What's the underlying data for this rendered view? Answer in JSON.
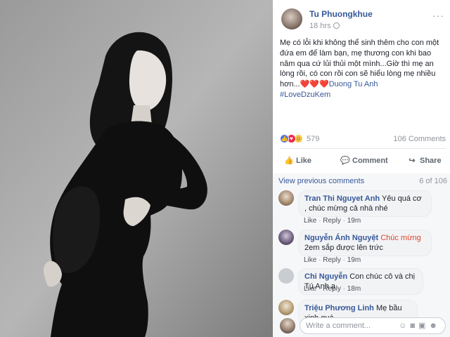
{
  "post": {
    "author": "Tu Phuongkhue",
    "time": "18 hrs",
    "text": "Mẹ có lỗi khi không thể sinh thêm cho con một đứa em để làm bạn, mẹ thương con khi bao năm qua cứ lủi thủi một mình...Giờ thì mẹ an lòng rồi, có con rồi con sẽ hiểu lòng mẹ nhiều hơn...",
    "hearts": "❤️❤️❤️",
    "mention": "Duong Tu Anh",
    "hashtag": "#LoveDzuKem",
    "reaction_count": "579",
    "comment_count": "106 Comments"
  },
  "actions": {
    "like": "Like",
    "comment": "Comment",
    "share": "Share"
  },
  "comments_section": {
    "view_previous": "View previous comments",
    "pager": "6 of 106",
    "items": [
      {
        "name": "Tran Thi Nguyet Anh",
        "text": "Yêu quá cơ , chúc mừng cả nhà nhé",
        "like": "Like",
        "reply": "Reply",
        "time": "19m"
      },
      {
        "name": "Nguyễn Ánh Nguyệt",
        "highlight": "Chúc mừng",
        "text": "2em sắp được lên trức",
        "like": "Like",
        "reply": "Reply",
        "time": "19m"
      },
      {
        "name": "Chi Nguyễn",
        "text": "Con chúc cô và chị Tú Anh ạ",
        "like": "Like",
        "reply": "Reply",
        "time": "18m"
      },
      {
        "name": "Triệu Phương Linh",
        "text": "Mẹ bầu xinh quá",
        "like": "",
        "reply": "",
        "time": ""
      }
    ],
    "write_placeholder": "Write a comment..."
  },
  "colors": {
    "link": "#365899",
    "accent_red": "#e0442e",
    "like_blue": "#4a76e8"
  },
  "icons": [
    "more-icon",
    "globe-icon",
    "like-reaction-icon",
    "love-reaction-icon",
    "haha-reaction-icon",
    "thumb-up-icon",
    "comment-icon",
    "share-icon",
    "emoji-icon",
    "camera-icon",
    "gif-icon",
    "sticker-icon"
  ]
}
